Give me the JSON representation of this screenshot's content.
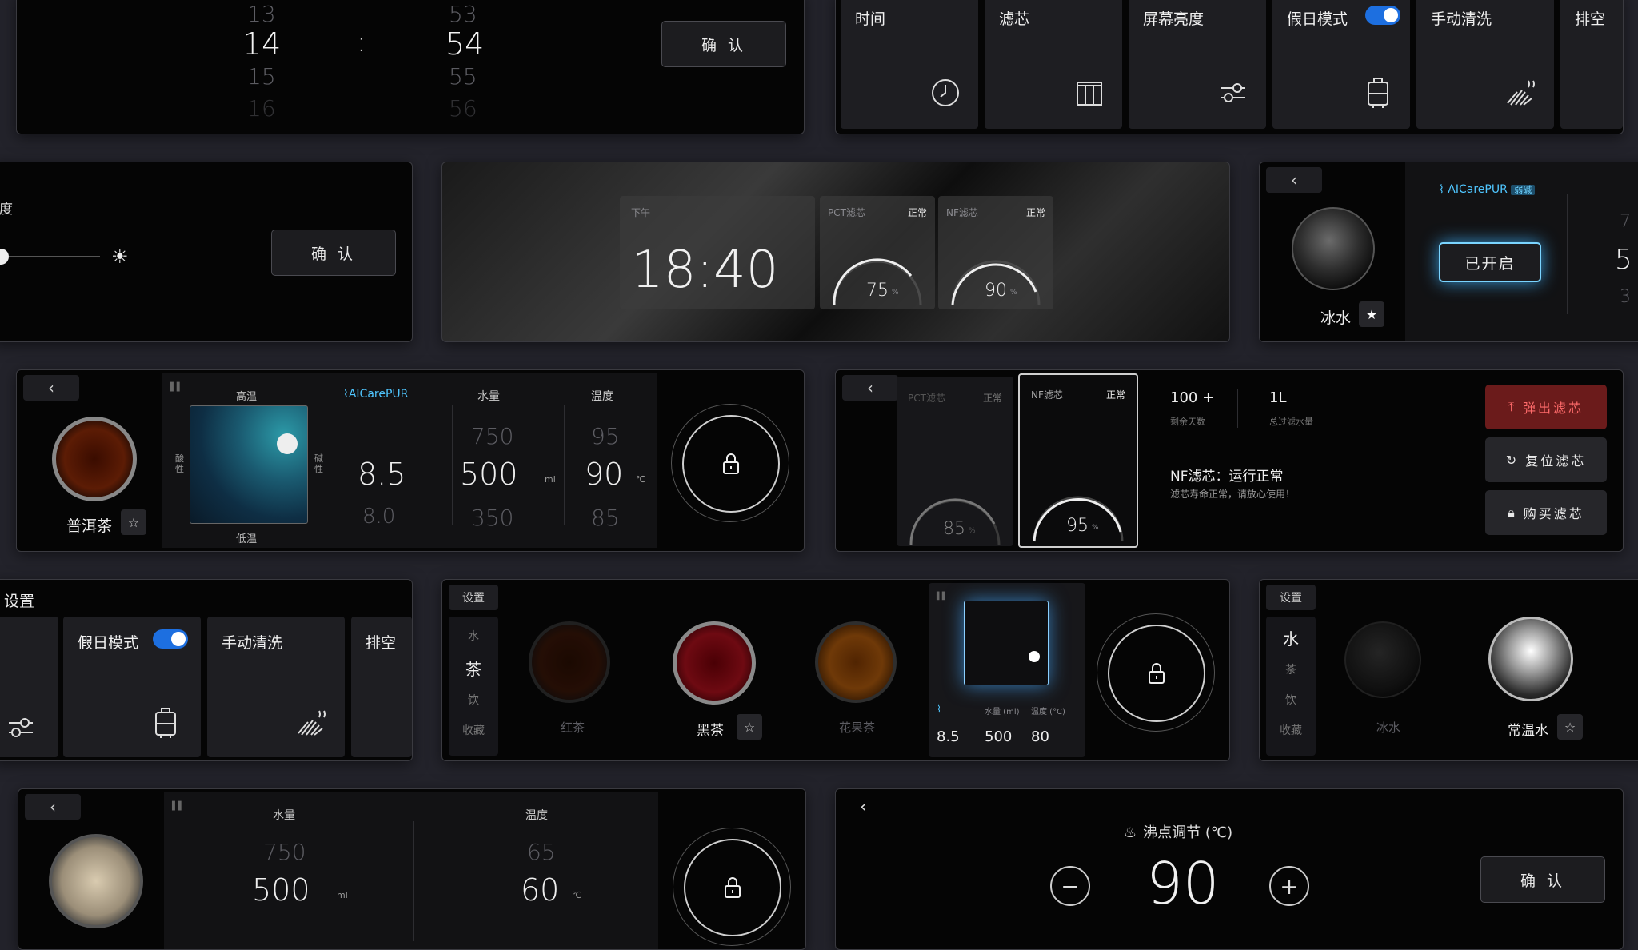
{
  "time_picker": {
    "hours": [
      "13",
      "14",
      "15",
      "16"
    ],
    "minutes": [
      "53",
      "54",
      "55",
      "56"
    ],
    "colon": ":",
    "confirm": "确 认"
  },
  "settings_top": {
    "tiles": [
      "时间",
      "滤芯",
      "屏幕亮度",
      "假日模式",
      "手动清洗",
      "排空"
    ],
    "holiday_on": true
  },
  "brightness": {
    "title": "度",
    "confirm": "确 认",
    "level": 0.0
  },
  "home": {
    "ampm": "下午",
    "time": "18:40",
    "pct_label": "PCT滤芯",
    "pct_status": "正常",
    "pct_value": "75",
    "nf_label": "NF滤芯",
    "nf_status": "正常",
    "nf_value": "90",
    "unit": "%"
  },
  "ice_panel": {
    "back": "‹",
    "drink": "冰水",
    "brand": "AICarePUR",
    "brand_tag": "弱碱",
    "status_btn": "已开启",
    "partial_top": "7",
    "partial_mid": "5",
    "partial_bot": "3"
  },
  "tea_panel": {
    "back": "‹",
    "drink": "普洱茶",
    "high": "高温",
    "low": "低温",
    "acid": "酸性",
    "alkali": "碱性",
    "brand": "AICarePUR",
    "ph_label": "",
    "ph": [
      "8.5",
      "8.0"
    ],
    "water_label": "水量",
    "water": [
      "750",
      "500",
      "350"
    ],
    "water_unit": "ml",
    "temp_label": "温度",
    "temp": [
      "95",
      "90",
      "85"
    ],
    "temp_unit": "℃"
  },
  "filter_panel": {
    "back": "‹",
    "pct_label": "PCT滤芯",
    "pct_status": "正常",
    "pct_value": "85",
    "nf_label": "NF滤芯",
    "nf_status": "正常",
    "nf_value": "95",
    "unit": "%",
    "days": "100 +",
    "days_label": "剩余天数",
    "volume": "1L",
    "volume_label": "总过滤水量",
    "status_title": "NF滤芯：运行正常",
    "status_desc": "滤芯寿命正常，请放心使用！",
    "btn_eject": "弹出滤芯",
    "btn_reset": "复位滤芯",
    "btn_buy": "购买滤芯"
  },
  "settings_mid": {
    "title": "设置",
    "tiles": [
      "假日模式",
      "手动清洗",
      "排空"
    ]
  },
  "tea_select": {
    "tab": "设置",
    "cats": [
      "水",
      "茶",
      "饮",
      "收藏"
    ],
    "teas": [
      "红茶",
      "黑茶",
      "花果茶"
    ],
    "ph": "8.5",
    "water_label": "水量 (ml)",
    "water": "500",
    "temp_label": "温度 (°C)",
    "temp": "80"
  },
  "water_select": {
    "tab": "设置",
    "cats": [
      "水",
      "茶",
      "饮",
      "收藏"
    ],
    "drinks": [
      "冰水",
      "常温水"
    ]
  },
  "milk_panel": {
    "back": "‹",
    "water_label": "水量",
    "water": [
      "750",
      "500"
    ],
    "water_unit": "ml",
    "temp_label": "温度",
    "temp": [
      "65",
      "60"
    ],
    "temp_unit": "℃"
  },
  "boil_panel": {
    "back": "‹",
    "title": "沸点调节 (℃)",
    "value": "90",
    "minus": "−",
    "plus": "+",
    "confirm": "确 认"
  }
}
